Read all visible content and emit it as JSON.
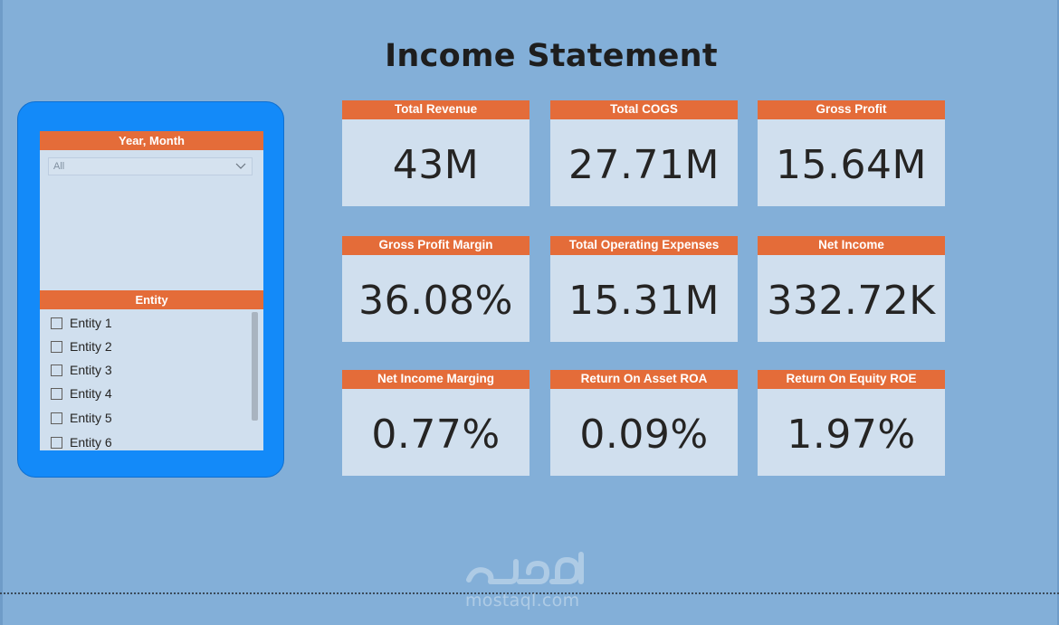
{
  "page": {
    "title": "Income Statement",
    "background": "#83afd8",
    "accent": "#e46c39",
    "slicer_frame": "#138af9"
  },
  "slicers": {
    "date": {
      "header": "Year, Month",
      "selected": "All",
      "icon": "chevron-down-icon"
    },
    "entity": {
      "header": "Entity",
      "items": [
        "Entity 1",
        "Entity 2",
        "Entity 3",
        "Entity 4",
        "Entity 5",
        "Entity 6"
      ]
    }
  },
  "cards": [
    {
      "label": "Total Revenue",
      "value": "43M"
    },
    {
      "label": "Total COGS",
      "value": "27.71M"
    },
    {
      "label": "Gross Profit",
      "value": "15.64M"
    },
    {
      "label": "Gross Profit Margin",
      "value": "36.08%"
    },
    {
      "label": "Total Operating Expenses",
      "value": "15.31M"
    },
    {
      "label": "Net Income",
      "value": "332.72K"
    },
    {
      "label": "Net Income Marging",
      "value": "0.77%"
    },
    {
      "label": "Return On Asset ROA",
      "value": "0.09%"
    },
    {
      "label": "Return On Equity ROE",
      "value": "1.97%"
    }
  ],
  "watermark": {
    "text": "mostaql.com"
  }
}
